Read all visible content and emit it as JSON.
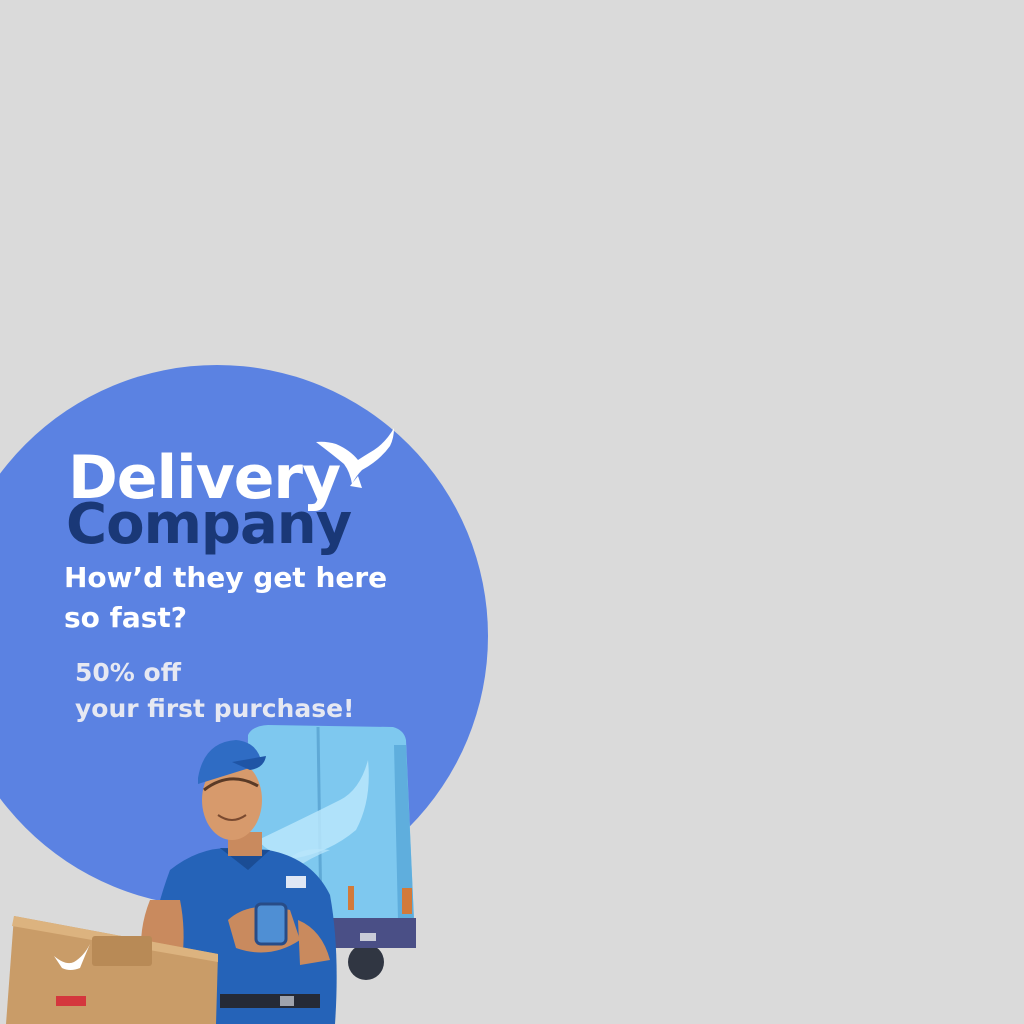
{
  "ad": {
    "title_line1": "Delivery",
    "title_line2": "Company",
    "tagline": "How’d they get here so fast?",
    "offer_line1": "50% off",
    "offer_line2": "your first purchase!"
  },
  "colors": {
    "background": "#dadada",
    "circle": "#5b82e2",
    "title_white": "#ffffff",
    "title_dark": "#1a3877",
    "van": "#7ec8ef",
    "uniform": "#2563b8"
  },
  "icons": {
    "logo": "white-bird-icon",
    "van": "delivery-van",
    "courier": "delivery-man",
    "parcel": "cardboard-box"
  }
}
